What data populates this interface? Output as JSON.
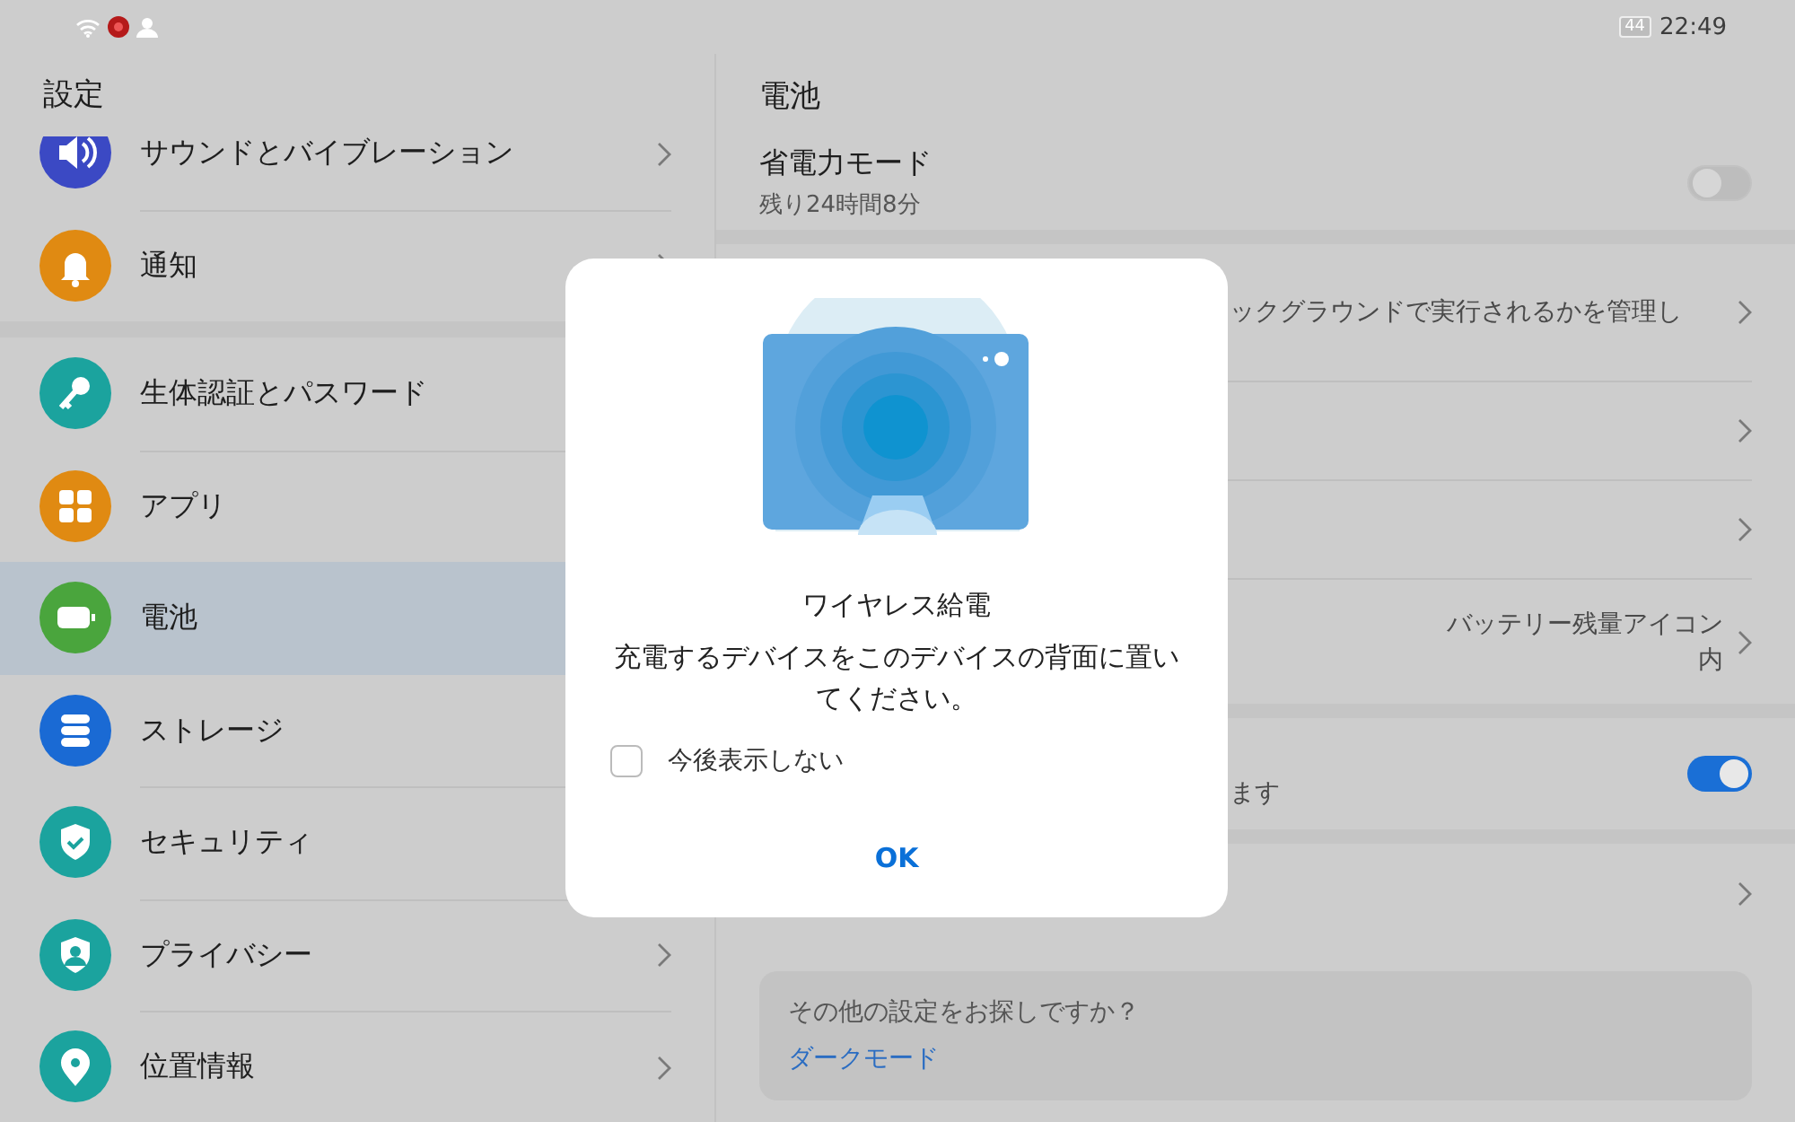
{
  "status_bar": {
    "battery": "44",
    "time": "22:49"
  },
  "sidebar": {
    "title": "設定",
    "groups": [
      {
        "items": [
          {
            "label": "サウンドとバイブレーション",
            "color": "#3b49c4",
            "selected": false,
            "chevron": true
          },
          {
            "label": "通知",
            "color": "#e08a12",
            "selected": false,
            "chevron": true
          }
        ]
      },
      {
        "items": [
          {
            "label": "生体認証とパスワード",
            "color": "#1ba39e",
            "selected": false,
            "chevron": false
          },
          {
            "label": "アプリ",
            "color": "#e08a12",
            "selected": false,
            "chevron": false
          },
          {
            "label": "電池",
            "color": "#4aa53d",
            "selected": true,
            "chevron": false
          },
          {
            "label": "ストレージ",
            "color": "#1a6ad4",
            "selected": false,
            "chevron": false
          },
          {
            "label": "セキュリティ",
            "color": "#1ba39e",
            "selected": false,
            "chevron": false
          },
          {
            "label": "プライバシー",
            "color": "#1ba39e",
            "selected": false,
            "chevron": true
          },
          {
            "label": "位置情報",
            "color": "#1ba39e",
            "selected": false,
            "chevron": true
          }
        ]
      }
    ]
  },
  "panel": {
    "title": "電池",
    "groups": [
      {
        "rows": [
          {
            "kind": "switch",
            "title": "省電力モード",
            "subtitle": "残り24時間8分",
            "on": false
          }
        ]
      },
      {
        "rows": [
          {
            "kind": "link",
            "text": "ックグラウンドで実行されるかを管理し"
          },
          {
            "kind": "link"
          },
          {
            "kind": "link"
          },
          {
            "kind": "value",
            "value": "バッテリー残量アイコン内"
          }
        ]
      },
      {
        "rows": [
          {
            "kind": "switch",
            "text": "ます",
            "on": true
          }
        ]
      },
      {
        "rows": [
          {
            "kind": "link"
          }
        ]
      }
    ],
    "card": {
      "question": "その他の設定をお探しですか？",
      "link": "ダークモード"
    }
  },
  "dialog": {
    "title": "ワイヤレス給電",
    "message": "充電するデバイスをこのデバイスの背面に置いてください。",
    "checkbox": {
      "label": "今後表示しない",
      "checked": false
    },
    "button": "OK"
  }
}
